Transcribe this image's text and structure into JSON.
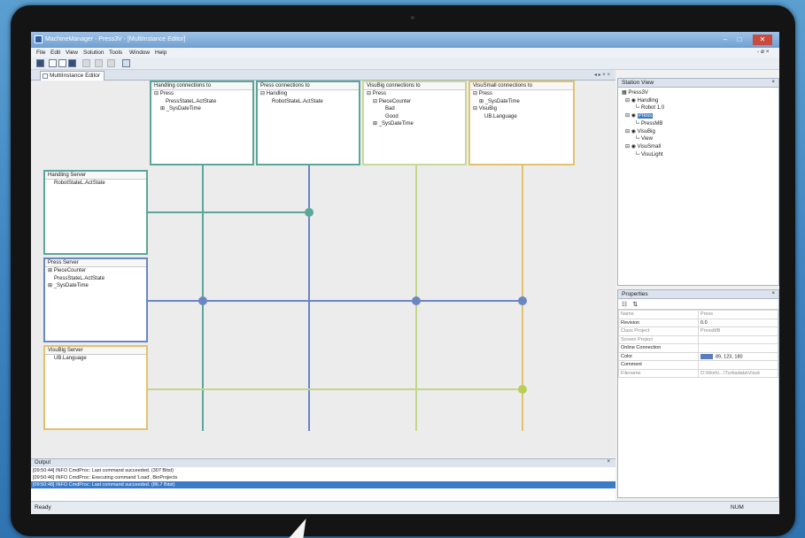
{
  "window": {
    "title": "MachineManager - Press3V - [MultiInstance Editor]",
    "controls": {
      "minimize": "–",
      "maximize": "□",
      "close": "✕"
    }
  },
  "menu": {
    "items": [
      "File",
      "Edit",
      "View",
      "Solution",
      "Tools",
      "Window",
      "Help"
    ],
    "right_controls": "- ø ×"
  },
  "doc_tab": {
    "label": "MultiInstance Editor",
    "controls": "◂ ▸ × ×"
  },
  "connection_boxes": [
    {
      "header": "Handling connections to",
      "lines": [
        "⊟ Press",
        "PressStateL.ActState",
        "⊞ _SysDateTime"
      ],
      "color": "#5aa79a"
    },
    {
      "header": "Press connections to",
      "lines": [
        "⊟ Handling",
        "RobotStateL.ActState"
      ],
      "color": "#5aa79a"
    },
    {
      "header": "VisuBig connections to",
      "lines": [
        "⊟ Press",
        "⊟ PieceCounter",
        "Bad",
        "Good",
        "⊞ _SysDateTime"
      ],
      "color": "#c8d898"
    },
    {
      "header": "VisuSmall connections to",
      "lines": [
        "⊟ Press",
        "⊞ _SysDateTime",
        "⊟ VisuBig",
        "UB.Language"
      ],
      "color": "#e2c36b"
    }
  ],
  "server_boxes": [
    {
      "header": "Handling Server",
      "lines": [
        "RobotStateL.ActState"
      ],
      "color": "#5aa79a"
    },
    {
      "header": "Press Server",
      "lines": [
        "⊞ PieceCounter",
        "PressStateL.ActState",
        "⊞ _SysDateTime"
      ],
      "color": "#6b86c4"
    },
    {
      "header": "VisuBig Server",
      "lines": [
        "UB.Language"
      ],
      "color": "#e2c36b"
    }
  ],
  "colors": {
    "handling": "#5aa79a",
    "press": "#6b86c4",
    "visubig": "#c4d68a",
    "visusmall": "#e2c36b",
    "selection": "#3d7ac6"
  },
  "station_view": {
    "title": "Station View",
    "tree": [
      {
        "label": "Press3V",
        "level": 0
      },
      {
        "label": "Handling",
        "level": 1
      },
      {
        "label": "Robot 1.0",
        "level": 2
      },
      {
        "label": "Press",
        "level": 1,
        "selected": true
      },
      {
        "label": "PressMB",
        "level": 2
      },
      {
        "label": "VisuBig",
        "level": 1
      },
      {
        "label": "View",
        "level": 2
      },
      {
        "label": "VisuSmall",
        "level": 1
      },
      {
        "label": "VisuLight",
        "level": 2
      }
    ]
  },
  "properties": {
    "title": "Properties",
    "rows": [
      {
        "key": "Name",
        "value": "Press",
        "dim": true
      },
      {
        "key": "Revision",
        "value": "0.0",
        "dim": false
      },
      {
        "key": "Class Project",
        "value": "PressMB",
        "dim": true
      },
      {
        "key": "Screen Project",
        "value": "",
        "dim": true
      },
      {
        "key": "Online Connection",
        "value": "",
        "dim": false
      },
      {
        "key": "Color",
        "value": "89, 123, 180",
        "dim": false,
        "swatch": "#5b7bc0"
      },
      {
        "key": "Comment",
        "value": "",
        "dim": false
      },
      {
        "key": "Filename",
        "value": "D:\\Work\\...\\Turbadata\\Visuk",
        "dim": true
      }
    ]
  },
  "output": {
    "title": "Output",
    "lines": [
      "[09:50:44] INFO CmdProc: Last command succeeded. (307 Bitst)",
      "[09:50:46] INFO CmdProc: Executing command 'Load', BinProjects",
      "[09:50:48] INFO CmdProc: Last command succeeded. (86.7 Bitst)"
    ]
  },
  "status": {
    "left": "Ready",
    "right": "NUM"
  }
}
